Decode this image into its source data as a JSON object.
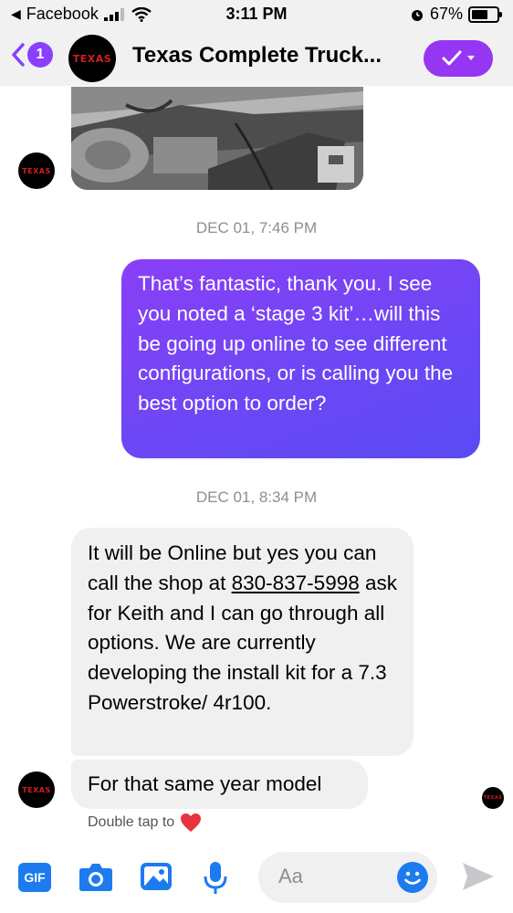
{
  "status_bar": {
    "back_app": "Facebook",
    "time": "3:11 PM",
    "battery": "67%",
    "battery_fraction": 0.67
  },
  "header": {
    "unread_count": "1",
    "title": "Texas Complete Truck...",
    "avatar_logo": "TEXAS",
    "action_icon": "check-dropdown-icon"
  },
  "thread": {
    "timestamp_1": "DEC 01, 7:46 PM",
    "outgoing_message": "That’s fantastic, thank you. I see you noted a ‘stage 3 kit’…will this be going up online to see different configurations, or is calling you the best option to order?",
    "timestamp_2": "DEC 01, 8:34 PM",
    "incoming_1_before": "It will be Online but yes you can call the shop at ",
    "incoming_1_phone": "830-837-5998",
    "incoming_1_after": " ask for Keith and I can go through all options. We are currently developing the install kit for a 7.3 Powerstroke/ 4r100.",
    "incoming_2": "For that same year model",
    "reaction_hint": "Double tap to",
    "reaction_icon": "heart-icon"
  },
  "composer": {
    "gif_label": "GIF",
    "placeholder": "Aa",
    "icons": [
      "camera-icon",
      "gallery-icon",
      "microphone-icon",
      "emoji-icon",
      "send-icon"
    ]
  },
  "colors": {
    "accent_purple": "#9536f3",
    "bubble_gradient_start": "#8a3ff6",
    "bubble_gradient_end": "#5a4bf3",
    "icon_blue": "#1d7bf0",
    "incoming_bubble": "#f0f0f0",
    "logo_red": "#d02020"
  }
}
